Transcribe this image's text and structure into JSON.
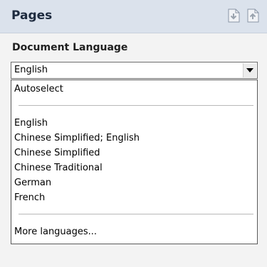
{
  "panel": {
    "title": "Pages",
    "icons": [
      "page-import-icon",
      "page-export-icon"
    ]
  },
  "document_language": {
    "label": "Document Language",
    "selected": "English",
    "options": {
      "autoselect": "Autoselect",
      "common": [
        "English",
        "Chinese Simplified; English",
        "Chinese Simplified",
        "Chinese Traditional",
        "German",
        "French"
      ],
      "more": "More languages..."
    }
  },
  "colors": {
    "header_bg": "#dbe2ec",
    "section_bg": "#f3f3f3"
  }
}
